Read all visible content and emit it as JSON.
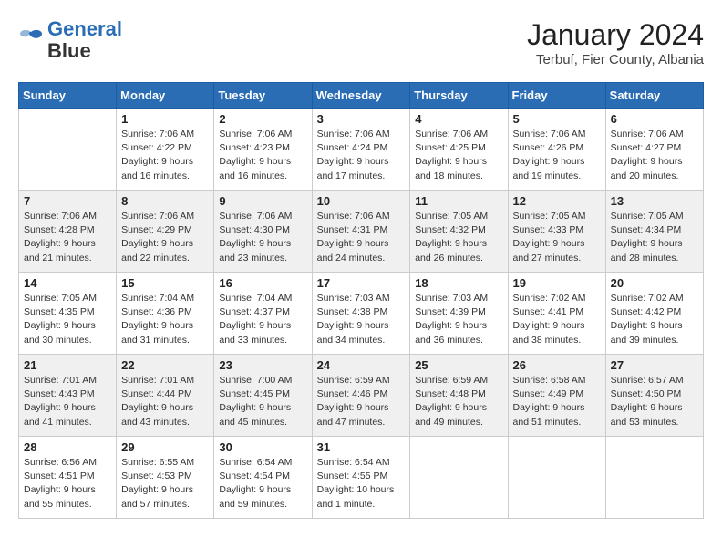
{
  "header": {
    "logo_line1": "General",
    "logo_line2": "Blue",
    "title": "January 2024",
    "subtitle": "Terbuf, Fier County, Albania"
  },
  "columns": [
    "Sunday",
    "Monday",
    "Tuesday",
    "Wednesday",
    "Thursday",
    "Friday",
    "Saturday"
  ],
  "weeks": [
    {
      "days": [
        {
          "num": "",
          "detail": ""
        },
        {
          "num": "1",
          "detail": "Sunrise: 7:06 AM\nSunset: 4:22 PM\nDaylight: 9 hours\nand 16 minutes."
        },
        {
          "num": "2",
          "detail": "Sunrise: 7:06 AM\nSunset: 4:23 PM\nDaylight: 9 hours\nand 16 minutes."
        },
        {
          "num": "3",
          "detail": "Sunrise: 7:06 AM\nSunset: 4:24 PM\nDaylight: 9 hours\nand 17 minutes."
        },
        {
          "num": "4",
          "detail": "Sunrise: 7:06 AM\nSunset: 4:25 PM\nDaylight: 9 hours\nand 18 minutes."
        },
        {
          "num": "5",
          "detail": "Sunrise: 7:06 AM\nSunset: 4:26 PM\nDaylight: 9 hours\nand 19 minutes."
        },
        {
          "num": "6",
          "detail": "Sunrise: 7:06 AM\nSunset: 4:27 PM\nDaylight: 9 hours\nand 20 minutes."
        }
      ]
    },
    {
      "days": [
        {
          "num": "7",
          "detail": "Sunrise: 7:06 AM\nSunset: 4:28 PM\nDaylight: 9 hours\nand 21 minutes."
        },
        {
          "num": "8",
          "detail": "Sunrise: 7:06 AM\nSunset: 4:29 PM\nDaylight: 9 hours\nand 22 minutes."
        },
        {
          "num": "9",
          "detail": "Sunrise: 7:06 AM\nSunset: 4:30 PM\nDaylight: 9 hours\nand 23 minutes."
        },
        {
          "num": "10",
          "detail": "Sunrise: 7:06 AM\nSunset: 4:31 PM\nDaylight: 9 hours\nand 24 minutes."
        },
        {
          "num": "11",
          "detail": "Sunrise: 7:05 AM\nSunset: 4:32 PM\nDaylight: 9 hours\nand 26 minutes."
        },
        {
          "num": "12",
          "detail": "Sunrise: 7:05 AM\nSunset: 4:33 PM\nDaylight: 9 hours\nand 27 minutes."
        },
        {
          "num": "13",
          "detail": "Sunrise: 7:05 AM\nSunset: 4:34 PM\nDaylight: 9 hours\nand 28 minutes."
        }
      ]
    },
    {
      "days": [
        {
          "num": "14",
          "detail": "Sunrise: 7:05 AM\nSunset: 4:35 PM\nDaylight: 9 hours\nand 30 minutes."
        },
        {
          "num": "15",
          "detail": "Sunrise: 7:04 AM\nSunset: 4:36 PM\nDaylight: 9 hours\nand 31 minutes."
        },
        {
          "num": "16",
          "detail": "Sunrise: 7:04 AM\nSunset: 4:37 PM\nDaylight: 9 hours\nand 33 minutes."
        },
        {
          "num": "17",
          "detail": "Sunrise: 7:03 AM\nSunset: 4:38 PM\nDaylight: 9 hours\nand 34 minutes."
        },
        {
          "num": "18",
          "detail": "Sunrise: 7:03 AM\nSunset: 4:39 PM\nDaylight: 9 hours\nand 36 minutes."
        },
        {
          "num": "19",
          "detail": "Sunrise: 7:02 AM\nSunset: 4:41 PM\nDaylight: 9 hours\nand 38 minutes."
        },
        {
          "num": "20",
          "detail": "Sunrise: 7:02 AM\nSunset: 4:42 PM\nDaylight: 9 hours\nand 39 minutes."
        }
      ]
    },
    {
      "days": [
        {
          "num": "21",
          "detail": "Sunrise: 7:01 AM\nSunset: 4:43 PM\nDaylight: 9 hours\nand 41 minutes."
        },
        {
          "num": "22",
          "detail": "Sunrise: 7:01 AM\nSunset: 4:44 PM\nDaylight: 9 hours\nand 43 minutes."
        },
        {
          "num": "23",
          "detail": "Sunrise: 7:00 AM\nSunset: 4:45 PM\nDaylight: 9 hours\nand 45 minutes."
        },
        {
          "num": "24",
          "detail": "Sunrise: 6:59 AM\nSunset: 4:46 PM\nDaylight: 9 hours\nand 47 minutes."
        },
        {
          "num": "25",
          "detail": "Sunrise: 6:59 AM\nSunset: 4:48 PM\nDaylight: 9 hours\nand 49 minutes."
        },
        {
          "num": "26",
          "detail": "Sunrise: 6:58 AM\nSunset: 4:49 PM\nDaylight: 9 hours\nand 51 minutes."
        },
        {
          "num": "27",
          "detail": "Sunrise: 6:57 AM\nSunset: 4:50 PM\nDaylight: 9 hours\nand 53 minutes."
        }
      ]
    },
    {
      "days": [
        {
          "num": "28",
          "detail": "Sunrise: 6:56 AM\nSunset: 4:51 PM\nDaylight: 9 hours\nand 55 minutes."
        },
        {
          "num": "29",
          "detail": "Sunrise: 6:55 AM\nSunset: 4:53 PM\nDaylight: 9 hours\nand 57 minutes."
        },
        {
          "num": "30",
          "detail": "Sunrise: 6:54 AM\nSunset: 4:54 PM\nDaylight: 9 hours\nand 59 minutes."
        },
        {
          "num": "31",
          "detail": "Sunrise: 6:54 AM\nSunset: 4:55 PM\nDaylight: 10 hours\nand 1 minute."
        },
        {
          "num": "",
          "detail": ""
        },
        {
          "num": "",
          "detail": ""
        },
        {
          "num": "",
          "detail": ""
        }
      ]
    }
  ]
}
